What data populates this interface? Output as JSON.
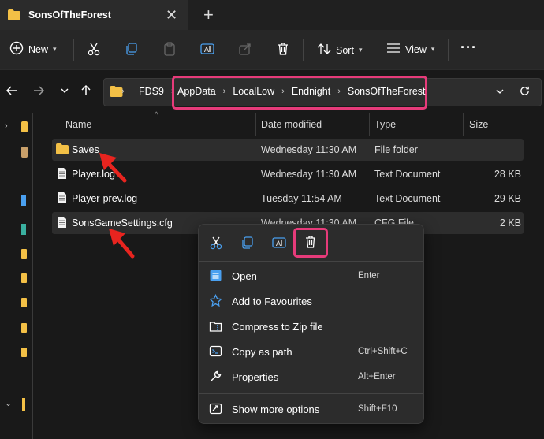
{
  "window": {
    "tab_title": "SonsOfTheForest",
    "tab_close": "✕",
    "new_tab": "+"
  },
  "toolbar": {
    "new_label": "New",
    "sort_label": "Sort",
    "view_label": "View",
    "more_label": "···"
  },
  "address": {
    "breadcrumbs": [
      "FDS9",
      "AppData",
      "LocalLow",
      "Endnight",
      "SonsOfTheForest"
    ]
  },
  "columns": {
    "name": "Name",
    "date": "Date modified",
    "type": "Type",
    "size": "Size"
  },
  "files": [
    {
      "name": "Saves",
      "date": "Wednesday 11:30 AM",
      "type": "File folder",
      "size": ""
    },
    {
      "name": "Player.log",
      "date": "Wednesday 11:30 AM",
      "type": "Text Document",
      "size": "28 KB"
    },
    {
      "name": "Player-prev.log",
      "date": "Tuesday 11:54 AM",
      "type": "Text Document",
      "size": "29 KB"
    },
    {
      "name": "SonsGameSettings.cfg",
      "date": "Wednesday 11:30 AM",
      "type": "CFG File",
      "size": "2 KB"
    }
  ],
  "context_menu": {
    "items": [
      {
        "label": "Open",
        "shortcut": "Enter",
        "icon": "notepad-icon"
      },
      {
        "label": "Add to Favourites",
        "shortcut": "",
        "icon": "star-icon"
      },
      {
        "label": "Compress to Zip file",
        "shortcut": "",
        "icon": "zip-icon"
      },
      {
        "label": "Copy as path",
        "shortcut": "Ctrl+Shift+C",
        "icon": "copy-path-icon"
      },
      {
        "label": "Properties",
        "shortcut": "Alt+Enter",
        "icon": "wrench-icon"
      },
      {
        "label": "Show more options",
        "shortcut": "Shift+F10",
        "icon": "more-options-icon"
      }
    ]
  },
  "colors": {
    "highlight": "#e63b7a",
    "annotation_arrow": "#e8241f",
    "folder_yellow": "#f3c046",
    "accent_blue": "#4aa0f0"
  }
}
